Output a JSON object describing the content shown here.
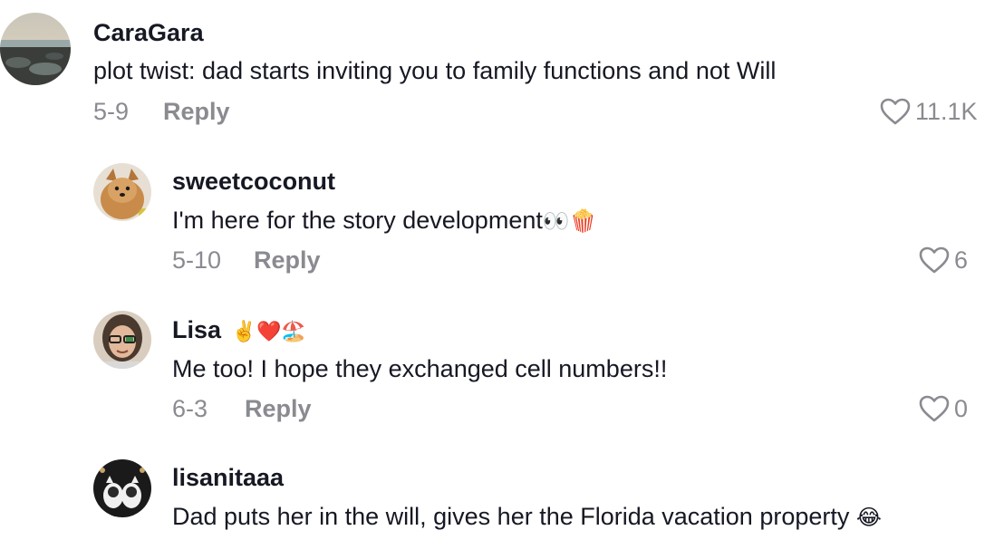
{
  "comments": [
    {
      "username": "CaraGara",
      "text": "plot twist: dad starts inviting you to family functions and not Will",
      "date": "5-9",
      "reply_label": "Reply",
      "likes": "11.1K",
      "avatar_icon": "beach-photo-avatar"
    },
    {
      "username": "sweetcoconut",
      "text": "I'm here for the story development",
      "text_emojis": "👀🍿",
      "date": "5-10",
      "reply_label": "Reply",
      "likes": "6",
      "avatar_icon": "dog-photo-avatar"
    },
    {
      "username": "Lisa",
      "username_emojis": "✌️❤️🏖️",
      "text": "Me too! I hope they exchanged cell numbers!!",
      "date": "6-3",
      "reply_label": "Reply",
      "likes": "0",
      "avatar_icon": "person-photo-avatar"
    },
    {
      "username": "lisanitaaa",
      "text": "Dad puts her in the will, gives her the Florida vacation property",
      "text_emojis": "😂",
      "avatar_icon": "cats-photo-avatar"
    }
  ],
  "colors": {
    "text": "#161823",
    "muted": "#8a8b91",
    "background": "#ffffff"
  }
}
